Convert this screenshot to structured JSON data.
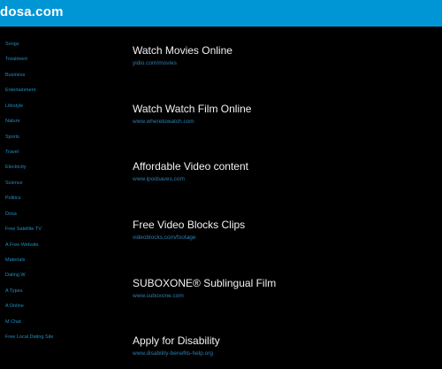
{
  "header": {
    "site_title": "dosa.com",
    "bar_color": "#0096d6"
  },
  "sidebar": {
    "link_color": "#1f8fc4",
    "items": [
      {
        "label": "Songs"
      },
      {
        "label": "Treatment"
      },
      {
        "label": "Business"
      },
      {
        "label": "Entertainment"
      },
      {
        "label": "Lifestyle"
      },
      {
        "label": "Nature"
      },
      {
        "label": "Sports"
      },
      {
        "label": "Travel"
      },
      {
        "label": "Electricity"
      },
      {
        "label": "Science"
      },
      {
        "label": "Politics"
      },
      {
        "label": "Dosa"
      },
      {
        "label": "Free Satellite TV"
      },
      {
        "label": "A Free Website"
      },
      {
        "label": "Materials"
      },
      {
        "label": "Dating W"
      },
      {
        "label": "A Types"
      },
      {
        "label": "A Online"
      },
      {
        "label": "M Chat"
      },
      {
        "label": "Free Local Dating Site"
      }
    ]
  },
  "results": [
    {
      "title": "Watch Movies Online",
      "url": "yidio.com/movies"
    },
    {
      "title": "Watch Watch Film Online",
      "url": "www.wheretowatch.com"
    },
    {
      "title": "Affordable Video content",
      "url": "www.ipodsaves.com"
    },
    {
      "title": "Free Video Blocks Clips",
      "url": "videoblocks.com/footage"
    },
    {
      "title": "SUBOXONE® Sublingual Film",
      "url": "www.suboxone.com"
    },
    {
      "title": "Apply for Disability",
      "url": "www.disability-benefits-help.org"
    }
  ]
}
